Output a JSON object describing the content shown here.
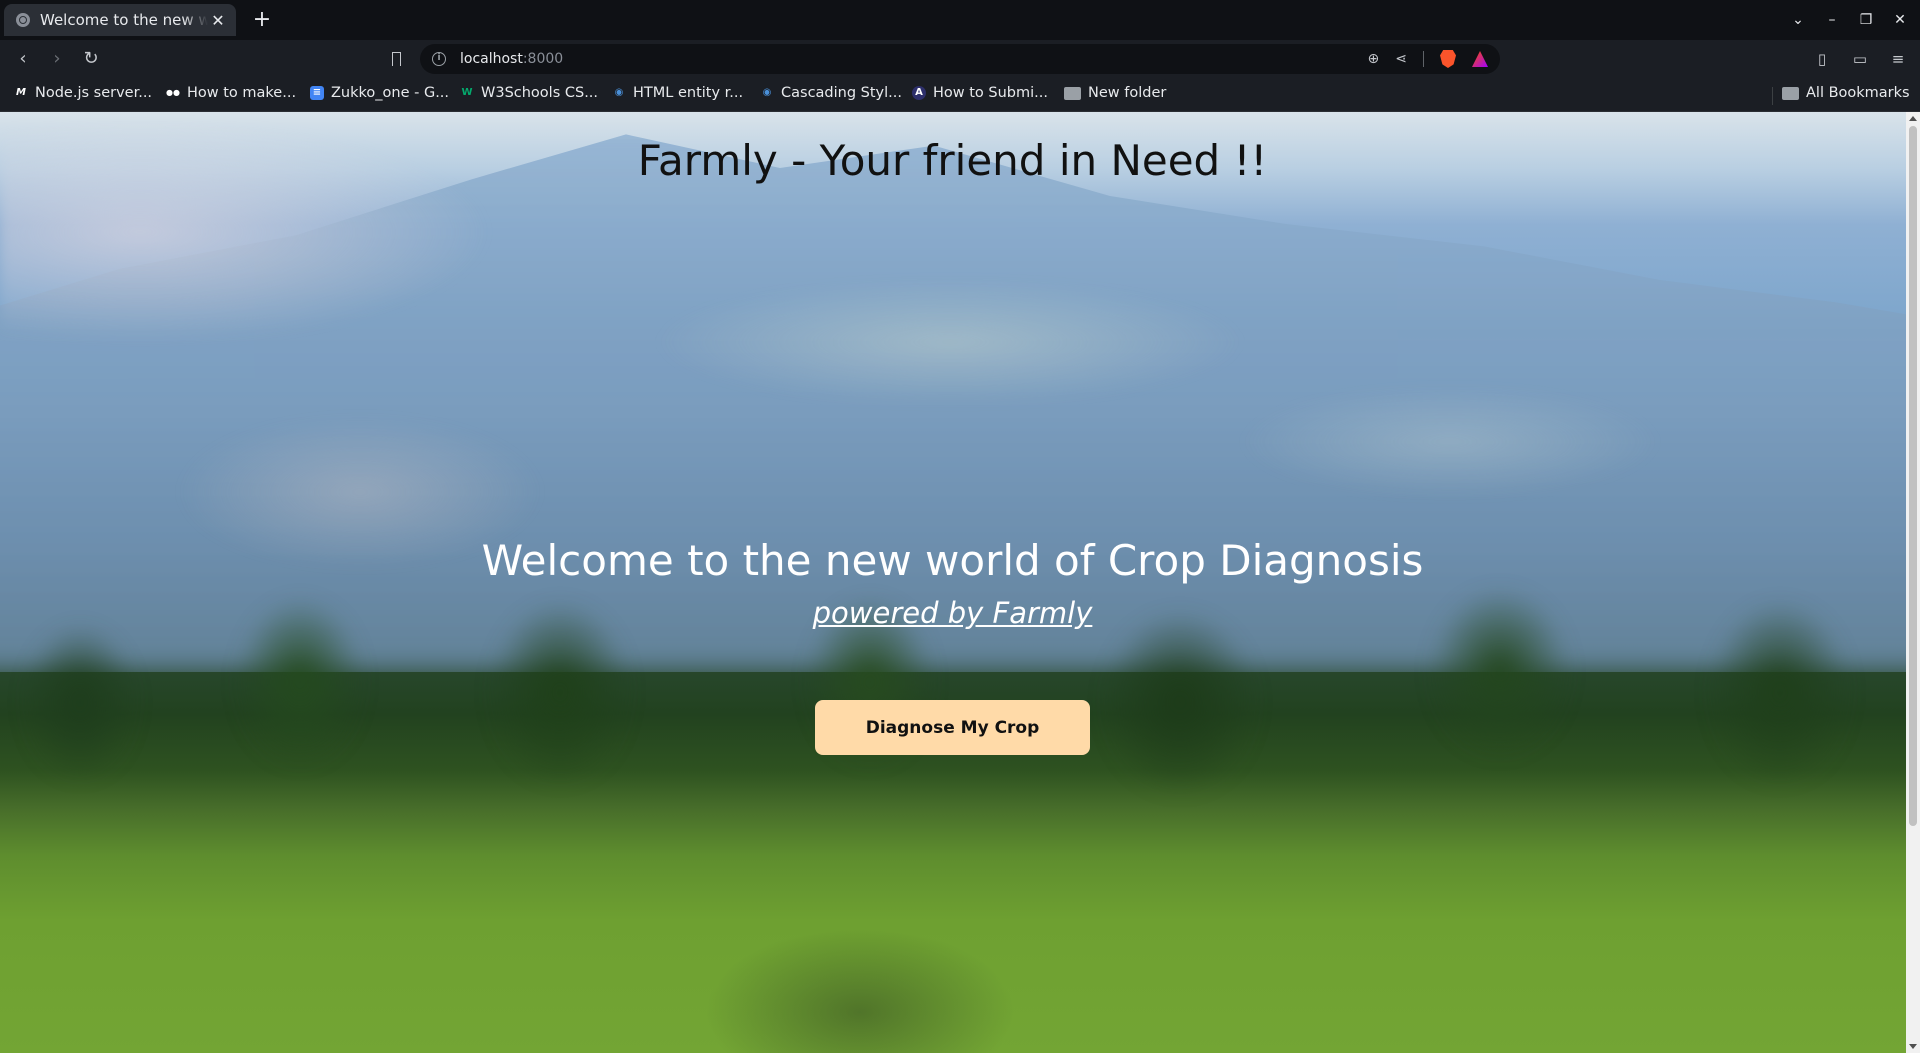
{
  "browser": {
    "tab": {
      "title": "Welcome to the new world of Crop Diagnosis",
      "close": "✕"
    },
    "new_tab": "+",
    "window_controls": {
      "dropdown": "⌄",
      "minimize": "–",
      "restore": "❐",
      "close": "✕"
    },
    "nav": {
      "back": "‹",
      "forward": "›",
      "reload": "↻"
    },
    "address": {
      "host": "localhost",
      "port": ":8000"
    },
    "address_icons": {
      "info": "i",
      "zoom": "⊕",
      "share": "⋖"
    },
    "toolbar_right": {
      "sidebar": "▯",
      "wallet": "▭",
      "menu": "≡"
    },
    "bookmarks": [
      {
        "label": "Node.js server...",
        "icon": "M",
        "color": "#1b1e24"
      },
      {
        "label": "How to make...",
        "icon": "●●",
        "color": "#000000"
      },
      {
        "label": "Zukko_one - G...",
        "icon": "≡",
        "color": "#4285f4"
      },
      {
        "label": "W3Schools CS...",
        "icon": "W",
        "color": "#04aa6d"
      },
      {
        "label": "HTML entity r...",
        "icon": "◉",
        "color": "#4a90d9"
      },
      {
        "label": "Cascading Styl...",
        "icon": "◉",
        "color": "#4a90d9"
      },
      {
        "label": "How to Submi...",
        "icon": "A",
        "color": "#2d2f6b"
      },
      {
        "label": "New folder",
        "icon": "folder"
      }
    ],
    "all_bookmarks": "All Bookmarks"
  },
  "page": {
    "brand_title": "Farmly - Your friend in Need !!",
    "welcome": "Welcome to the new world of Crop Diagnosis",
    "powered_by": "powered by Farmly",
    "cta_label": "Diagnose My Crop"
  }
}
